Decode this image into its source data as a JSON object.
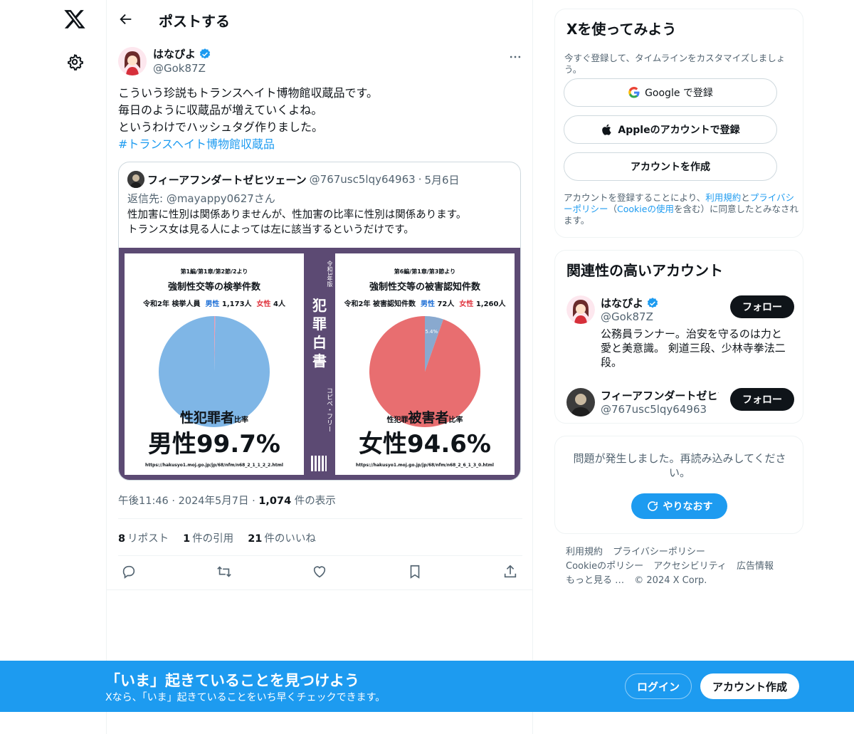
{
  "header": {
    "title": "ポストする"
  },
  "post": {
    "author_name": "はなぴよ",
    "author_handle": "@Gok87Z",
    "text_lines": [
      "こういう珍説もトランスヘイト博物館収蔵品です。",
      "毎日のように収蔵品が増えていくよね。",
      "というわけでハッシュタグ作りました。"
    ],
    "hashtag": "#トランスヘイト博物館収蔵品",
    "quote": {
      "author_name": "フィーアフンダートゼヒツェーン",
      "author_handle": "@767usc5lqy64963",
      "separator": "·",
      "date": "5月6日",
      "reply_to": "返信先: @mayappy0627さん",
      "text_lines": [
        "性加害に性別は関係ありませんが、性加害の比率に性別は関係あります。",
        "トランス女は見る人によっては左に該当するというだけです。"
      ],
      "image": {
        "spine_era": "令和3年版",
        "spine_title": "犯罪白書",
        "spine_sub": "コピペ・フリー",
        "left": {
          "source": "第1編/第1章/第2節/2より",
          "title": "強制性交等の検挙件数",
          "stats_prefix": "令和2年 検挙人員",
          "male_label": "男性",
          "male_value": "1,173人",
          "female_label": "女性",
          "female_value": "4人",
          "caption_main": "性犯罪者",
          "caption_suffix": "比率",
          "headline": "男性99.7%",
          "url": "https://hakusyo1.moj.go.jp/jp/68/nfm/n68_2_1_1_2_2.html",
          "male_fraction": 0.997,
          "male_color": "#7fb6e6",
          "female_color": "#f29bb0"
        },
        "right": {
          "source": "第6編/第1章/第3節より",
          "title": "強制性交等の被害認知件数",
          "stats_prefix": "令和2年 被害認知件数",
          "male_label": "男性",
          "male_value": "72人",
          "female_label": "女性",
          "female_value": "1,260人",
          "caption_prefix": "性犯罪",
          "caption_main": "被害者",
          "caption_suffix": "比率",
          "slice_label": "5.4%",
          "headline": "女性94.6%",
          "url": "https://hakusyo1.moj.go.jp/jp/68/nfm/n68_2_6_1_3_0.html",
          "female_fraction": 0.946,
          "male_color": "#89a9cf",
          "female_color": "#e86e70"
        }
      }
    },
    "time": "午後11:46",
    "dot": "·",
    "date": "2024年5月7日",
    "views_count": "1,074",
    "views_label": "件の表示",
    "reposts_count": "8",
    "reposts_label": "リポスト",
    "quotes_count": "1",
    "quotes_label": "件の引用",
    "likes_count": "21",
    "likes_label": "件のいいね"
  },
  "signup": {
    "title": "Xを使ってみよう",
    "subtitle": "今すぐ登録して、タイムラインをカスタマイズしましょう。",
    "google_label": "Google で登録",
    "apple_label": "Appleのアカウントで登録",
    "create_label": "アカウントを作成",
    "legal_prefix": "アカウントを登録することにより、",
    "terms": "利用規約",
    "and": "と",
    "privacy": "プライバシーポリシー",
    "cookie_open": "（",
    "cookie": "Cookieの使用",
    "legal_suffix": "を含む）に同意したとみなされます。"
  },
  "related": {
    "title": "関連性の高いアカウント",
    "accounts": [
      {
        "name": "はなぴよ",
        "handle": "@Gok87Z",
        "bio": "公務員ランナー。治安を守るのは力と愛と美意識。 剣道三段、少林寺拳法二段。",
        "follow": "フォロー"
      },
      {
        "name": "フィーアフンダートゼヒツェーン",
        "handle": "@767usc5lqy64963",
        "follow": "フォロー"
      }
    ]
  },
  "error_card": {
    "message": "問題が発生しました。再読み込みしてください。",
    "retry": "やりなおす"
  },
  "footer": {
    "links": [
      "利用規約",
      "プライバシーポリシー",
      "Cookieのポリシー",
      "アクセシビリティ",
      "広告情報",
      "もっと見る …",
      "© 2024 X Corp."
    ]
  },
  "banner": {
    "heading": "「いま」起きていることを見つけよう",
    "sub": "Xなら、「いま」起きていることをいち早くチェックできます。",
    "login": "ログイン",
    "create": "アカウント作成"
  },
  "colors": {
    "accent": "#1d9bf0",
    "text": "#0f1419",
    "muted": "#536471"
  }
}
